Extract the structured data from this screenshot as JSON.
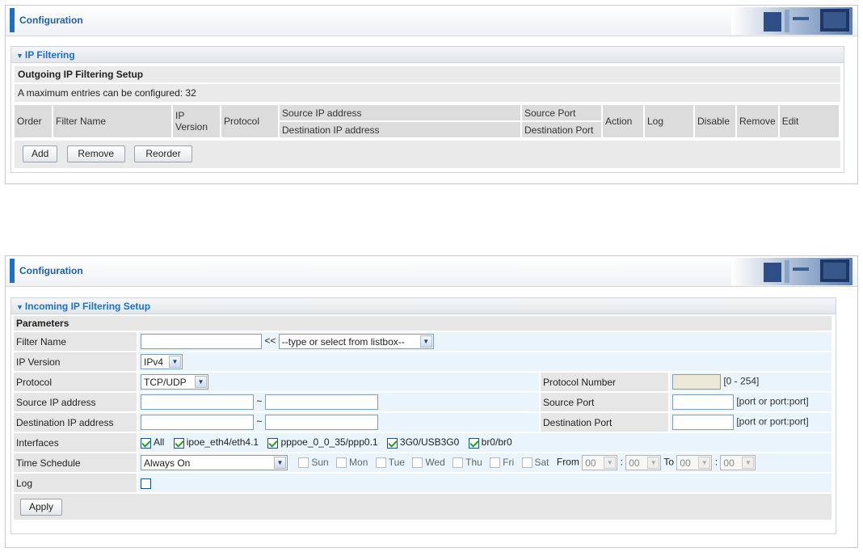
{
  "panel1": {
    "header": {
      "title": "Configuration"
    },
    "section_title": "IP Filtering",
    "subheading": "Outgoing IP Filtering Setup",
    "max_entries_text": "A maximum entries can be configured: 32",
    "columns": {
      "order": "Order",
      "filter_name": "Filter Name",
      "ip_version": "IP Version",
      "protocol": "Protocol",
      "source_ip": "Source IP address",
      "dest_ip": "Destination IP address",
      "source_port": "Source Port",
      "dest_port": "Destination Port",
      "action": "Action",
      "log": "Log",
      "disable": "Disable",
      "remove": "Remove",
      "edit": "Edit"
    },
    "buttons": {
      "add": "Add",
      "remove": "Remove",
      "reorder": "Reorder"
    }
  },
  "panel2": {
    "header": {
      "title": "Configuration"
    },
    "section_title": "Incoming IP Filtering Setup",
    "parameters_label": "Parameters",
    "filter_name": {
      "label": "Filter Name",
      "value": "",
      "sep": "<<",
      "listbox": "--type or select from listbox--"
    },
    "ip_version": {
      "label": "IP Version",
      "value": "IPv4"
    },
    "protocol": {
      "label": "Protocol",
      "value": "TCP/UDP"
    },
    "protocol_number": {
      "label": "Protocol Number",
      "value": "",
      "hint": "[0 - 254]"
    },
    "source_ip": {
      "label": "Source IP address",
      "from": "",
      "tilde": "~",
      "to": ""
    },
    "source_port": {
      "label": "Source Port",
      "value": "",
      "hint": "[port or port:port]"
    },
    "dest_ip": {
      "label": "Destination IP address",
      "from": "",
      "tilde": "~",
      "to": ""
    },
    "dest_port": {
      "label": "Destination Port",
      "value": "",
      "hint": "[port or port:port]"
    },
    "interfaces": {
      "label": "Interfaces",
      "items": [
        "All",
        "ipoe_eth4/eth4.1",
        "pppoe_0_0_35/ppp0.1",
        "3G0/USB3G0",
        "br0/br0"
      ]
    },
    "time_schedule": {
      "label": "Time Schedule",
      "value": "Always On",
      "days": [
        "Sun",
        "Mon",
        "Tue",
        "Wed",
        "Thu",
        "Fri",
        "Sat"
      ],
      "from_label": "From",
      "to_label": "To",
      "from_hour": "00",
      "from_min": "00",
      "to_hour": "00",
      "to_min": "00",
      "colon": ":"
    },
    "log": {
      "label": "Log"
    },
    "apply_button": "Apply"
  },
  "colors": {
    "accent": "#1f6fc3",
    "label_bg": "#e6e6e6",
    "field_bg": "#e9f4fd"
  }
}
